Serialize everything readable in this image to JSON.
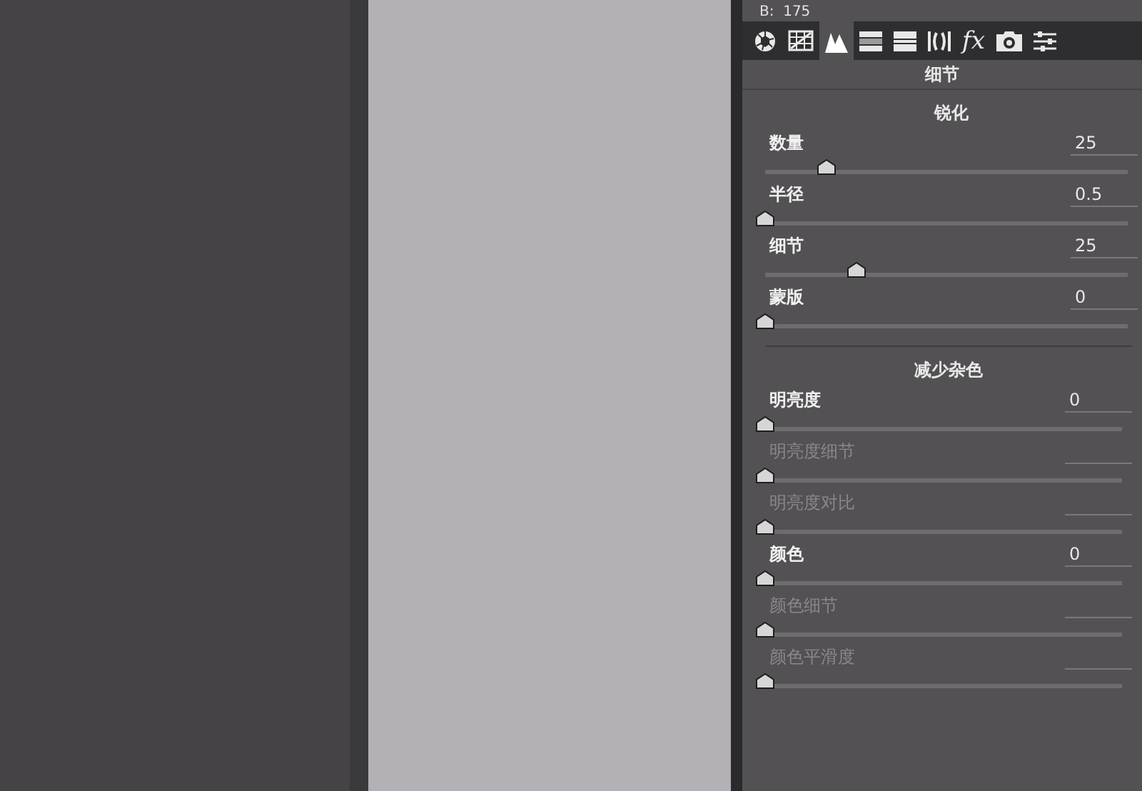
{
  "top_readout": "B:  175",
  "tabs": [
    {
      "kind": "aperture",
      "selected": false
    },
    {
      "kind": "grid",
      "selected": false
    },
    {
      "kind": "mountains",
      "selected": true
    },
    {
      "kind": "bars",
      "selected": false
    },
    {
      "kind": "split",
      "selected": false
    },
    {
      "kind": "lens",
      "selected": false
    },
    {
      "kind": "fx",
      "label": "fx",
      "selected": false
    },
    {
      "kind": "camera",
      "selected": false
    },
    {
      "kind": "sliders",
      "selected": false
    }
  ],
  "panel_title": "细节",
  "sections": [
    {
      "title": "锐化",
      "sliders": [
        {
          "label": "数量",
          "value": "25",
          "level": 0.17,
          "disabled": false
        },
        {
          "label": "半径",
          "value": "0.5",
          "level": 0,
          "disabled": false
        },
        {
          "label": "细节",
          "value": "25",
          "level": 0.25,
          "disabled": false
        },
        {
          "label": "蒙版",
          "value": "0",
          "level": 0,
          "disabled": false
        }
      ]
    },
    {
      "title": "减少杂色",
      "sliders": [
        {
          "label": "明亮度",
          "value": "0",
          "level": 0,
          "disabled": false
        },
        {
          "label": "明亮度细节",
          "level": 0,
          "disabled": true
        },
        {
          "label": "明亮度对比",
          "level": 0,
          "disabled": true
        },
        {
          "label": "颜色",
          "value": "0",
          "level": 0,
          "disabled": false
        },
        {
          "label": "颜色细节",
          "level": 0,
          "disabled": true
        },
        {
          "label": "颜色平滑度",
          "level": 0,
          "disabled": true
        }
      ]
    }
  ]
}
